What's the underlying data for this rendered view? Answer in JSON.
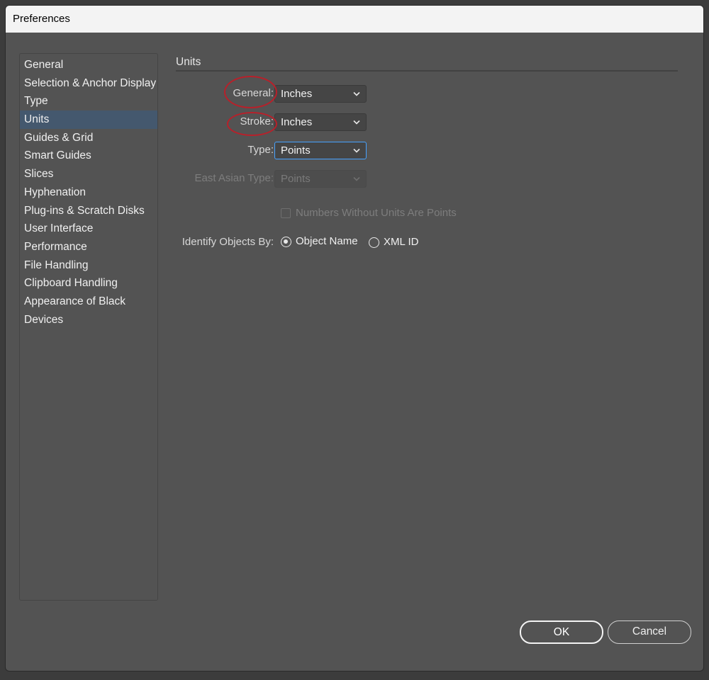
{
  "window": {
    "title": "Preferences"
  },
  "sidebar": {
    "items": [
      {
        "label": "General"
      },
      {
        "label": "Selection & Anchor Display"
      },
      {
        "label": "Type"
      },
      {
        "label": "Units",
        "selected": true
      },
      {
        "label": "Guides & Grid"
      },
      {
        "label": "Smart Guides"
      },
      {
        "label": "Slices"
      },
      {
        "label": "Hyphenation"
      },
      {
        "label": "Plug-ins & Scratch Disks"
      },
      {
        "label": "User Interface"
      },
      {
        "label": "Performance"
      },
      {
        "label": "File Handling"
      },
      {
        "label": "Clipboard Handling"
      },
      {
        "label": "Appearance of Black"
      },
      {
        "label": "Devices"
      }
    ]
  },
  "units": {
    "section_title": "Units",
    "general": {
      "label": "General:",
      "value": "Inches"
    },
    "stroke": {
      "label": "Stroke:",
      "value": "Inches"
    },
    "type": {
      "label": "Type:",
      "value": "Points"
    },
    "east_asian_type": {
      "label": "East Asian Type:",
      "value": "Points",
      "enabled": false
    },
    "numbers_without_units": {
      "label": "Numbers Without Units Are Points",
      "checked": false,
      "enabled": false
    },
    "identify_objects_by": {
      "label": "Identify Objects By:",
      "options": [
        {
          "label": "Object Name",
          "checked": true
        },
        {
          "label": "XML ID",
          "checked": false
        }
      ]
    }
  },
  "buttons": {
    "ok": "OK",
    "cancel": "Cancel"
  },
  "colors": {
    "panel_bg": "#535353",
    "selected_item": "#44586e",
    "focus_border": "#46a2ff",
    "annotation_ring": "#b8202a"
  },
  "icons": {
    "dropdown": "chevron-down-icon"
  }
}
